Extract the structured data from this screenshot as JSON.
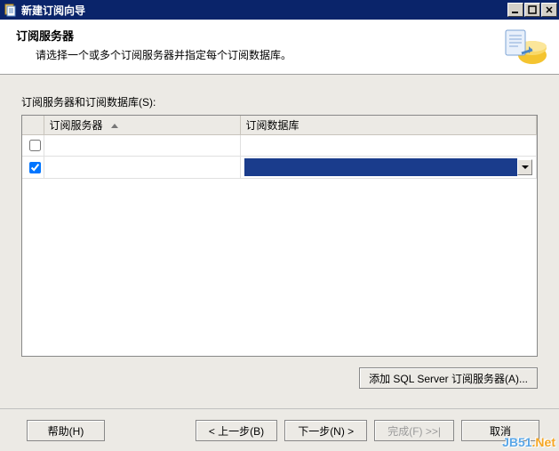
{
  "window": {
    "title": "新建订阅向导"
  },
  "header": {
    "title": "订阅服务器",
    "subtitle": "请选择一个或多个订阅服务器并指定每个订阅数据库。"
  },
  "main": {
    "tableLabel": "订阅服务器和订阅数据库(S):",
    "columns": {
      "server": "订阅服务器",
      "database": "订阅数据库"
    },
    "rows": [
      {
        "checked": false,
        "server": "",
        "database": "",
        "hasSelect": false
      },
      {
        "checked": true,
        "server": "",
        "database": "",
        "hasSelect": true
      }
    ],
    "addButton": "添加 SQL Server 订阅服务器(A)..."
  },
  "footer": {
    "help": "帮助(H)",
    "back": "< 上一步(B)",
    "next": "下一步(N) >",
    "finish": "完成(F) >>|",
    "cancel": "取消"
  },
  "watermark": {
    "a": "JB51",
    "b": ".Net"
  }
}
